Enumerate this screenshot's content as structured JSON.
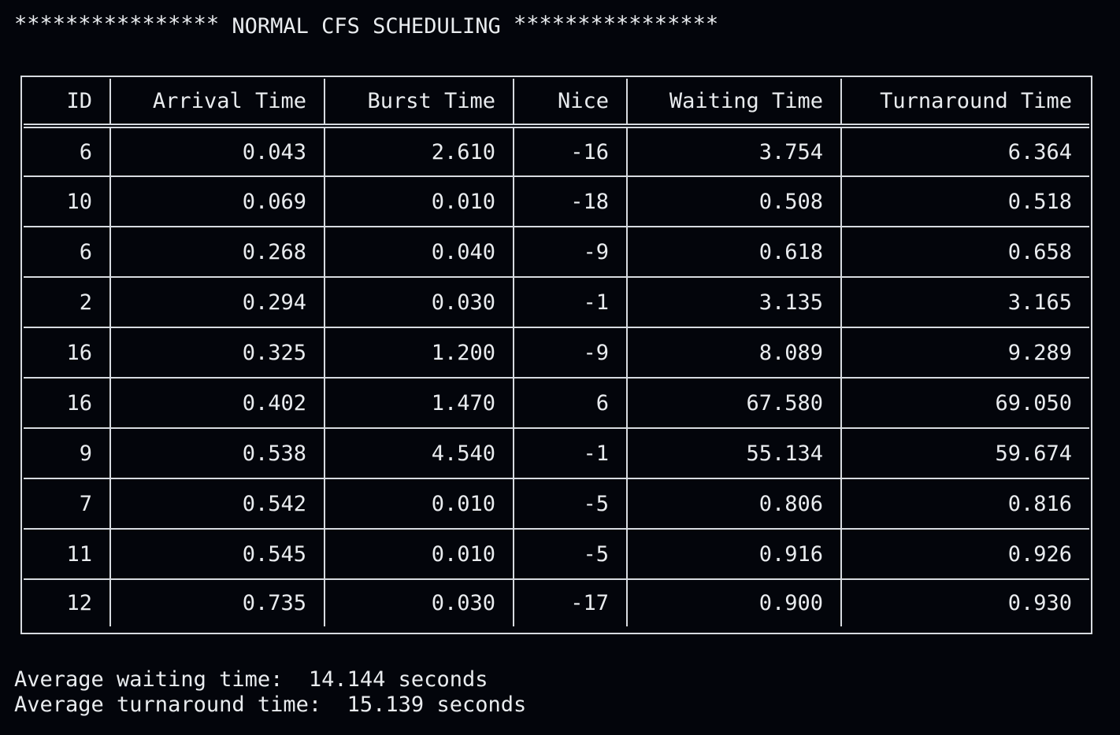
{
  "title": {
    "stars_left": "****************",
    "text": "NORMAL CFS SCHEDULING",
    "stars_right": "****************"
  },
  "table": {
    "columns": [
      "ID",
      "Arrival Time",
      "Burst Time",
      "Nice",
      "Waiting Time",
      "Turnaround Time"
    ],
    "rows": [
      [
        "6",
        "0.043",
        "2.610",
        "-16",
        "3.754",
        "6.364"
      ],
      [
        "10",
        "0.069",
        "0.010",
        "-18",
        "0.508",
        "0.518"
      ],
      [
        "6",
        "0.268",
        "0.040",
        "-9",
        "0.618",
        "0.658"
      ],
      [
        "2",
        "0.294",
        "0.030",
        "-1",
        "3.135",
        "3.165"
      ],
      [
        "16",
        "0.325",
        "1.200",
        "-9",
        "8.089",
        "9.289"
      ],
      [
        "16",
        "0.402",
        "1.470",
        "6",
        "67.580",
        "69.050"
      ],
      [
        "9",
        "0.538",
        "4.540",
        "-1",
        "55.134",
        "59.674"
      ],
      [
        "7",
        "0.542",
        "0.010",
        "-5",
        "0.806",
        "0.816"
      ],
      [
        "11",
        "0.545",
        "0.010",
        "-5",
        "0.916",
        "0.926"
      ],
      [
        "12",
        "0.735",
        "0.030",
        "-17",
        "0.900",
        "0.930"
      ]
    ]
  },
  "summary": {
    "avg_waiting_label": "Average waiting time:",
    "avg_waiting_value": "14.144 seconds",
    "avg_turnaround_label": "Average turnaround time:",
    "avg_turnaround_value": "15.139 seconds"
  }
}
